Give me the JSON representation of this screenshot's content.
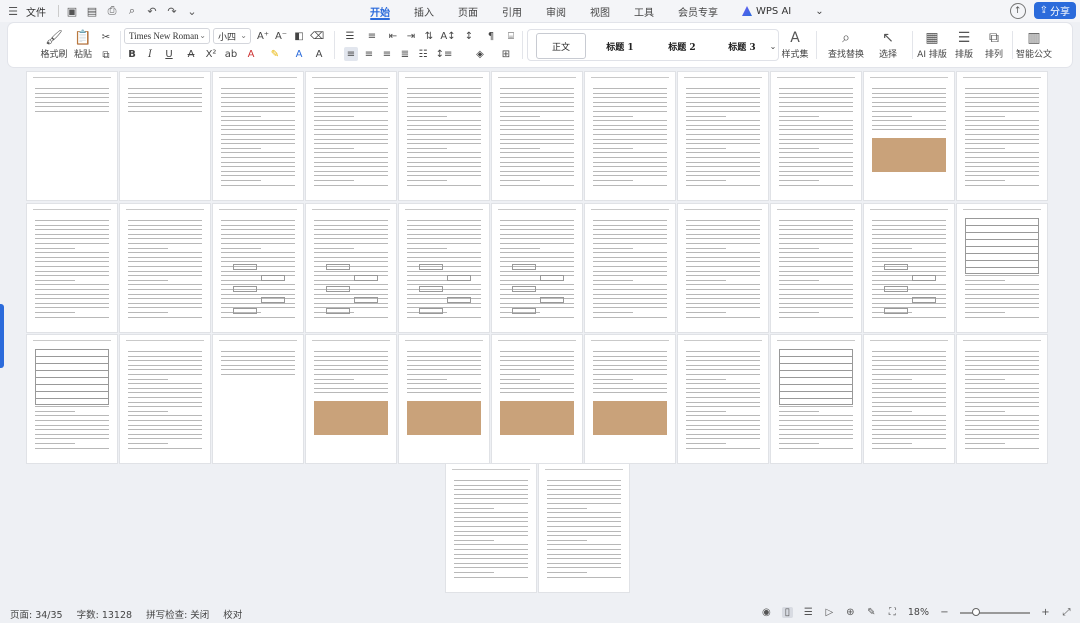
{
  "menubar": {
    "file_label": "文件",
    "tabs": [
      "开始",
      "插入",
      "页面",
      "引用",
      "审阅",
      "视图",
      "工具",
      "会员专享",
      "WPS AI"
    ],
    "active_tab": "开始",
    "share_label": "分享"
  },
  "ribbon": {
    "format_painter": "格式刷",
    "paste": "粘贴",
    "font_name": "Times New Roman",
    "font_size": "小四",
    "styles": [
      "正文",
      "标题 1",
      "标题 2",
      "标题 3"
    ],
    "style_set": "样式集",
    "find_replace": "查找替换",
    "select": "选择",
    "ai_layout": "AI 排版",
    "layout": "排版",
    "arrange": "排列",
    "smart_doc": "智能公文"
  },
  "status": {
    "page": "页面: 34/35",
    "word_count": "字数: 13128",
    "spell_check": "拼写检查: 关闭",
    "proofread": "校对",
    "zoom": "18%"
  }
}
